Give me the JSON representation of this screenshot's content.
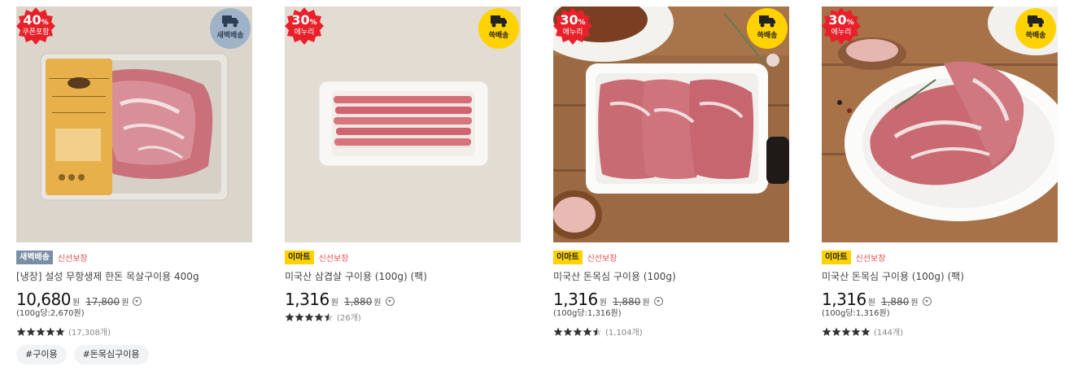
{
  "products": [
    {
      "discount_percent": "40",
      "discount_unit": "%",
      "discount_label": "쿠폰포함",
      "shipping_label": "새벽배송",
      "badge": "새벽배송",
      "fresh_label": "신선보장",
      "name": "[냉장] 설성 무항생제 한돈 목살구이용 400g",
      "price": "10,680",
      "currency": "원",
      "original_price": "17,800",
      "unit_price": "(100g당:2,670원)",
      "rating_stars": 5,
      "review_count": "(17,308개)"
    },
    {
      "discount_percent": "30",
      "discount_unit": "%",
      "discount_label": "에누리",
      "shipping_label": "쓱배송",
      "badge": "이마트",
      "fresh_label": "신선보장",
      "name": "미국산 삼겹살 구이용 (100g) (팩)",
      "price": "1,316",
      "currency": "원",
      "original_price": "1,880",
      "unit_price": "",
      "rating_stars": 4.5,
      "review_count": "(26개)"
    },
    {
      "discount_percent": "30",
      "discount_unit": "%",
      "discount_label": "에누리",
      "shipping_label": "쓱배송",
      "badge": "이마트",
      "fresh_label": "신선보장",
      "name": "미국산 돈목심 구이용 (100g)",
      "price": "1,316",
      "currency": "원",
      "original_price": "1,880",
      "unit_price": "(100g당:1,316원)",
      "rating_stars": 4.5,
      "review_count": "(1,104개)"
    },
    {
      "discount_percent": "30",
      "discount_unit": "%",
      "discount_label": "에누리",
      "shipping_label": "쓱배송",
      "badge": "이마트",
      "fresh_label": "신선보장",
      "name": "미국산 돈목심 구이용 (100g) (팩)",
      "price": "1,316",
      "currency": "원",
      "original_price": "1,880",
      "unit_price": "(100g당:1,316원)",
      "rating_stars": 5,
      "review_count": "(144개)"
    }
  ],
  "tags": [
    "#구이용",
    "#돈목심구이용"
  ],
  "colors": {
    "discount_red": "#e8202a",
    "dawn_blue": "#9fb3c8",
    "ssg_yellow": "#ffd200",
    "fresh_red": "#e94b4b"
  },
  "icons": {
    "discount_badge": "starburst-badge",
    "shipping": "truck-icon",
    "rating": "star-icon",
    "price_info": "chevron-down-circle-icon"
  },
  "package_label": {
    "brand": "설성목장",
    "line1": "무항생제 설성한돈",
    "line2": "무항생제 한돈 목심"
  }
}
